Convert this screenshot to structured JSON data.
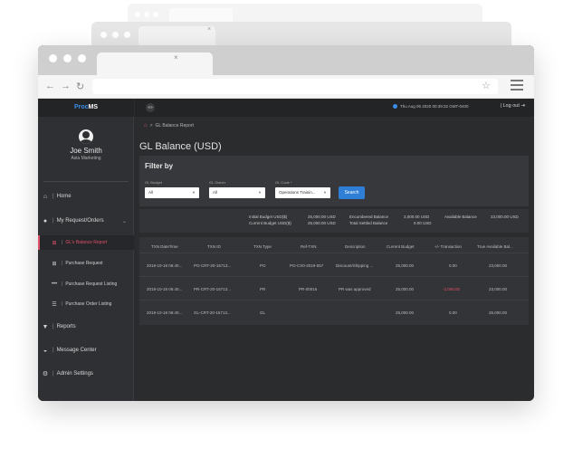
{
  "app": {
    "logo_part1": "Proc",
    "logo_part2": "MS"
  },
  "topbar": {
    "collapse_icon": "«»",
    "datetime": "Thu Aug 06 2020 00:39:32 GMT-0400",
    "logout_label": "Log out"
  },
  "user": {
    "name": "Joe Smith",
    "role": "Asia Marketing"
  },
  "sidebar": {
    "items": [
      {
        "label": "Home",
        "icon": "home-icon"
      },
      {
        "label": "My Request/Orders",
        "icon": "orders-icon"
      },
      {
        "label": "Reports",
        "icon": "filter-icon"
      },
      {
        "label": "Message Center",
        "icon": "chat-icon"
      },
      {
        "label": "Admin Settings",
        "icon": "gear-icon"
      }
    ],
    "subitems": [
      {
        "label": "GL's Balance Report",
        "active": true
      },
      {
        "label": "Purchase Request",
        "active": false
      },
      {
        "label": "Purchase Request Listing",
        "active": false
      },
      {
        "label": "Purchase Order Listing",
        "active": false
      }
    ]
  },
  "breadcrumb": {
    "sep": ">",
    "current": "GL Balance Report"
  },
  "page": {
    "title": "GL Balance (USD)"
  },
  "filter": {
    "title": "Filter by",
    "gl_budget": {
      "label": "GL Budget",
      "value": "All"
    },
    "gl_owner": {
      "label": "GL Owner",
      "value": "All"
    },
    "gl_code": {
      "label": "GL Code",
      "required_mark": "*",
      "value": "Operations Trainin..."
    },
    "search_label": "Search"
  },
  "summary": {
    "initial_budget_label": "Initial Budget USD($)",
    "initial_budget_value": "25,000.00 USD",
    "current_budget_label": "Current Budget USD($)",
    "current_budget_value": "25,000.00 USD",
    "encumbered_label": "Encumbered Balance",
    "encumbered_value": "2,000.00 USD",
    "settled_label": "Total Settled Balance",
    "settled_value": "0.00 USD",
    "available_label": "Available Balance",
    "available_value": "23,000.00 USD"
  },
  "table": {
    "headers": [
      "TXN DateTime",
      "TXN ID",
      "TXN Type",
      "Ref-TXN",
      "Description",
      "Current Budget",
      "+/- Transaction",
      "True Available Bal..."
    ],
    "rows": [
      [
        "2019-10-18 06:40...",
        "PO-CRT-20-15713...",
        "PO",
        "PO-CX0-2019-557",
        "Discount/Shipping ...",
        "25,000.00",
        "0.00",
        "23,000.00"
      ],
      [
        "2019-10-18 06:40...",
        "PR-CRT-20-15713...",
        "PR",
        "PR-00016",
        "PR was approved",
        "25,000.00",
        "-2,000.00",
        "23,000.00"
      ],
      [
        "2019-10-18 06:40...",
        "GL-CRT-20-15713...",
        "GL",
        "",
        "",
        "25,000.00",
        "0.00",
        "25,000.00"
      ]
    ]
  }
}
